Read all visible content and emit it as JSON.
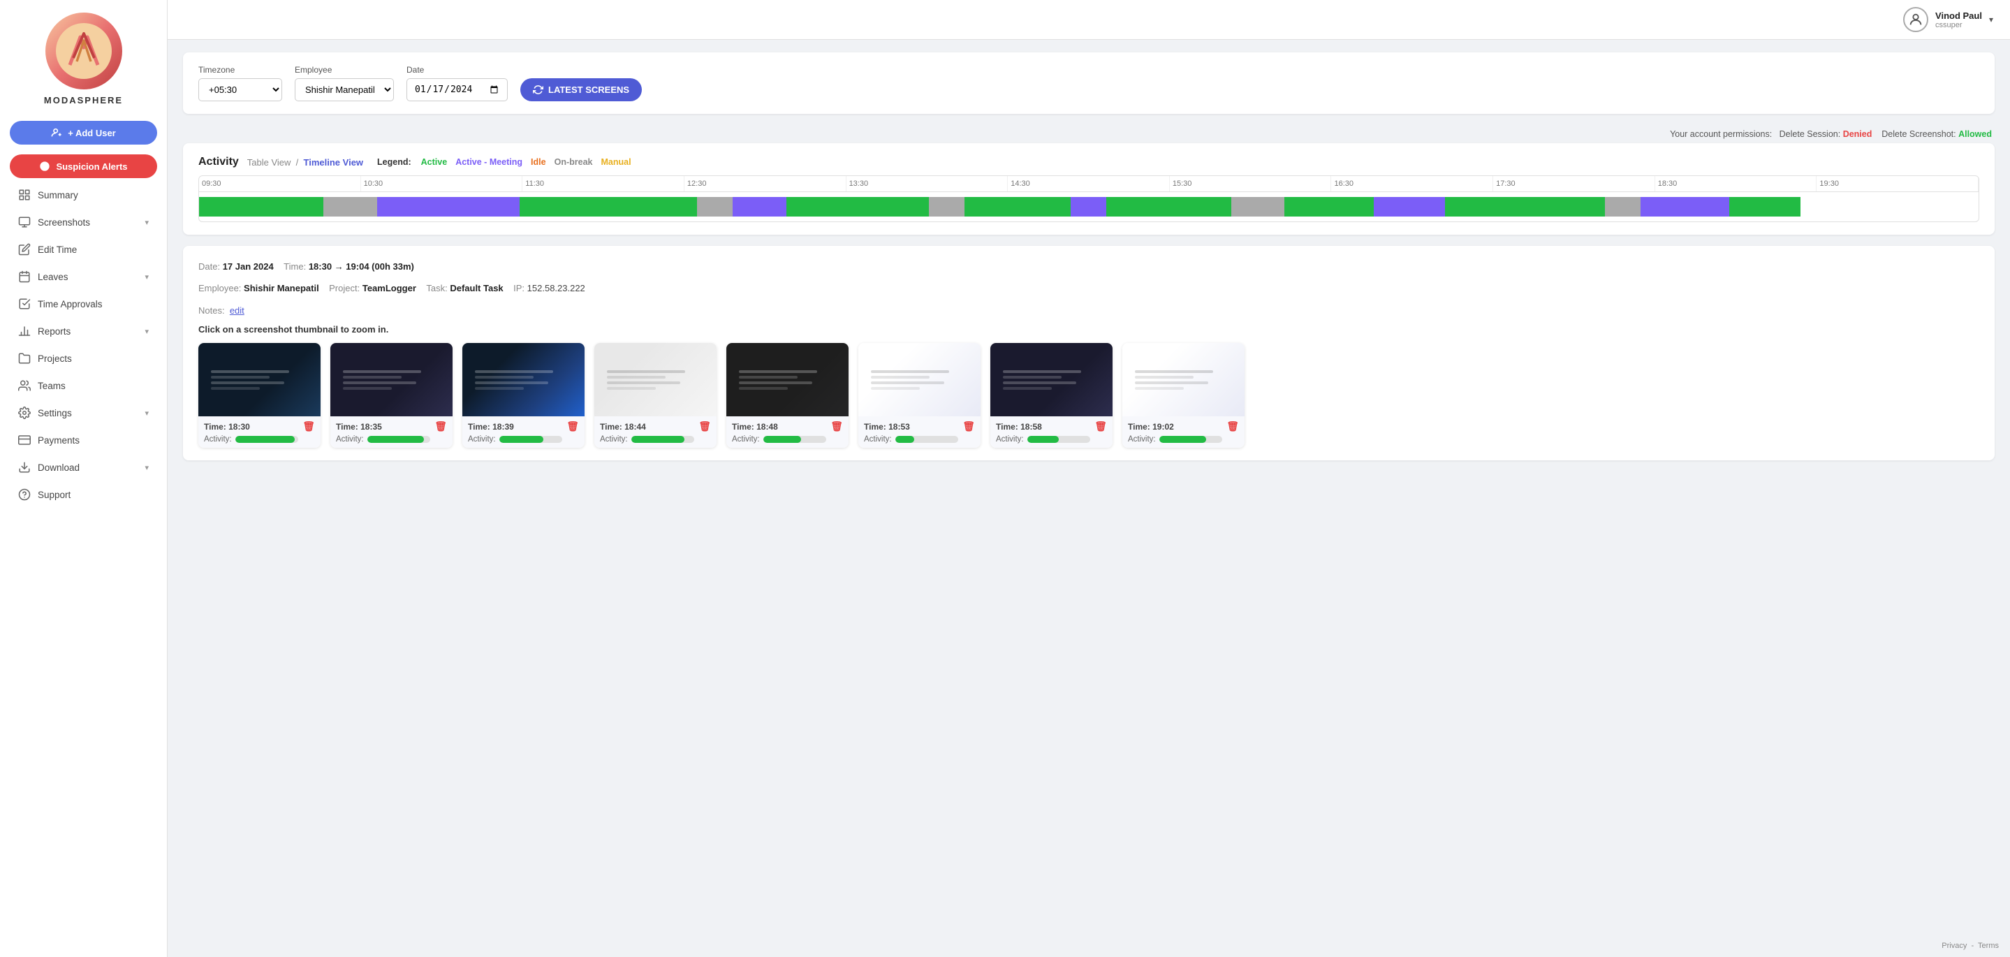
{
  "sidebar": {
    "logo_text": "MODASPHERE",
    "add_user_label": "+ Add User",
    "suspicion_alerts_label": "Suspicion Alerts",
    "nav_items": [
      {
        "id": "summary",
        "label": "Summary",
        "icon": "grid-icon",
        "has_chevron": false
      },
      {
        "id": "screenshots",
        "label": "Screenshots",
        "icon": "monitor-icon",
        "has_chevron": true
      },
      {
        "id": "edit-time",
        "label": "Edit Time",
        "icon": "edit-icon",
        "has_chevron": false
      },
      {
        "id": "leaves",
        "label": "Leaves",
        "icon": "calendar-icon",
        "has_chevron": true
      },
      {
        "id": "time-approvals",
        "label": "Time Approvals",
        "icon": "check-icon",
        "has_chevron": false
      },
      {
        "id": "reports",
        "label": "Reports",
        "icon": "bar-chart-icon",
        "has_chevron": true
      },
      {
        "id": "projects",
        "label": "Projects",
        "icon": "folder-icon",
        "has_chevron": false
      },
      {
        "id": "teams",
        "label": "Teams",
        "icon": "people-icon",
        "has_chevron": false
      },
      {
        "id": "settings",
        "label": "Settings",
        "icon": "gear-icon",
        "has_chevron": true
      },
      {
        "id": "payments",
        "label": "Payments",
        "icon": "credit-card-icon",
        "has_chevron": false
      },
      {
        "id": "download",
        "label": "Download",
        "icon": "download-icon",
        "has_chevron": true
      },
      {
        "id": "support",
        "label": "Support",
        "icon": "question-icon",
        "has_chevron": false
      }
    ]
  },
  "topbar": {
    "user_name": "Vinod Paul",
    "user_role": "cssuper"
  },
  "filters": {
    "timezone_label": "Timezone",
    "timezone_value": "+05:30",
    "employee_label": "Employee",
    "employee_value": "Shishir Manepatil",
    "date_label": "Date",
    "date_value": "2024-01-17",
    "latest_screens_label": "LATEST SCREENS"
  },
  "permissions": {
    "text": "Your account permissions:",
    "delete_session_label": "Delete Session:",
    "delete_session_value": "Denied",
    "delete_screenshot_label": "Delete Screenshot:",
    "delete_screenshot_value": "Allowed"
  },
  "activity": {
    "title": "Activity",
    "table_view_label": "Table View",
    "timeline_view_label": "Timeline View",
    "separator": "/",
    "legend_label": "Legend:",
    "legend_active": "Active",
    "legend_meeting": "Active - Meeting",
    "legend_idle": "Idle",
    "legend_onbreak": "On-break",
    "legend_manual": "Manual",
    "ticks": [
      "09:30",
      "10:30",
      "11:30",
      "12:30",
      "13:30",
      "14:30",
      "15:30",
      "16:30",
      "17:30",
      "18:30",
      "19:30"
    ]
  },
  "session": {
    "date_label": "Date:",
    "date_value": "17 Jan 2024",
    "time_label": "Time:",
    "time_value": "18:30 → 19:04 (00h 33m)",
    "employee_label": "Employee:",
    "employee_value": "Shishir Manepatil",
    "project_label": "Project:",
    "project_value": "TeamLogger",
    "task_label": "Task:",
    "task_value": "Default Task",
    "ip_label": "IP:",
    "ip_value": "152.58.23.222",
    "notes_label": "Notes:",
    "edit_label": "edit",
    "click_info": "Click on a screenshot thumbnail to zoom in."
  },
  "screenshots": [
    {
      "time": "18:30",
      "activity_pct": 95,
      "theme": "dark-blue"
    },
    {
      "time": "18:35",
      "activity_pct": 90,
      "theme": "dark-code"
    },
    {
      "time": "18:39",
      "activity_pct": 70,
      "theme": "chat-blue"
    },
    {
      "time": "18:44",
      "activity_pct": 85,
      "theme": "light-gray"
    },
    {
      "time": "18:48",
      "activity_pct": 60,
      "theme": "dark-editor"
    },
    {
      "time": "18:53",
      "activity_pct": 30,
      "theme": "light-product"
    },
    {
      "time": "18:58",
      "activity_pct": 50,
      "theme": "dark-code"
    },
    {
      "time": "19:02",
      "activity_pct": 75,
      "theme": "light-product"
    }
  ],
  "footer": {
    "privacy_label": "Privacy",
    "terms_label": "Terms"
  }
}
